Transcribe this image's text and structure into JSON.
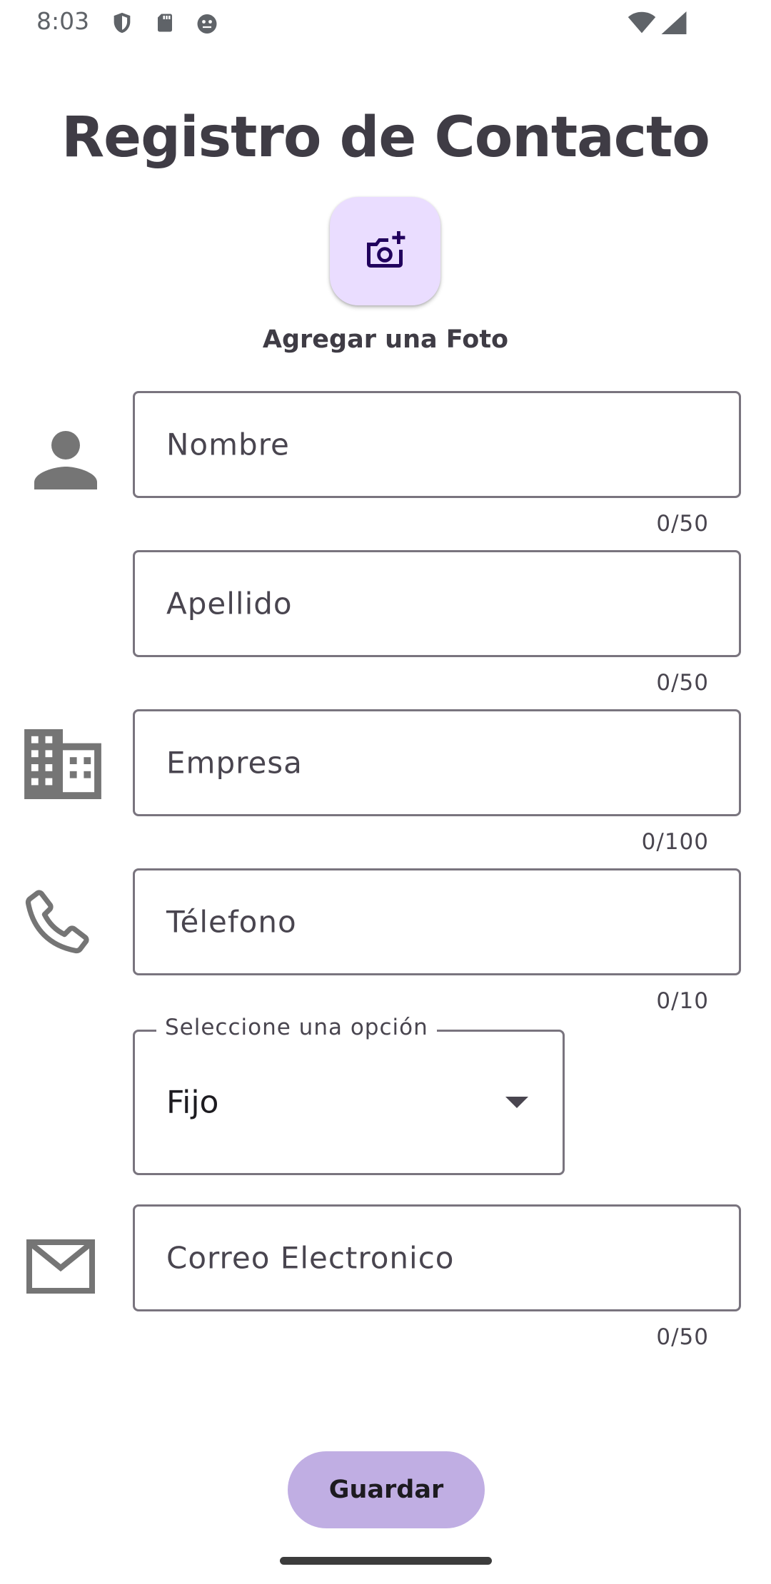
{
  "status_bar": {
    "time": "8:03"
  },
  "header": {
    "title": "Registro de Contacto"
  },
  "photo": {
    "icon": "add-a-photo-icon",
    "label": "Agregar una Foto"
  },
  "form": {
    "first_name": {
      "placeholder": "Nombre",
      "value": "",
      "counter": "0/50",
      "icon": "person-icon"
    },
    "last_name": {
      "placeholder": "Apellido",
      "value": "",
      "counter": "0/50"
    },
    "company": {
      "placeholder": "Empresa",
      "value": "",
      "counter": "0/100",
      "icon": "business-icon"
    },
    "phone": {
      "placeholder": "Télefono",
      "value": "",
      "counter": "0/10",
      "icon": "phone-icon"
    },
    "phone_type": {
      "label": "Seleccione una opción",
      "selected": "Fijo"
    },
    "email": {
      "placeholder": "Correo Electronico",
      "value": "",
      "counter": "0/50",
      "icon": "mail-icon"
    }
  },
  "actions": {
    "save_label": "Guardar"
  },
  "colors": {
    "photo_button_bg": "#eaddff",
    "save_button_bg": "#c0aee3",
    "outline": "#79747e",
    "icon_gray": "#757575"
  }
}
